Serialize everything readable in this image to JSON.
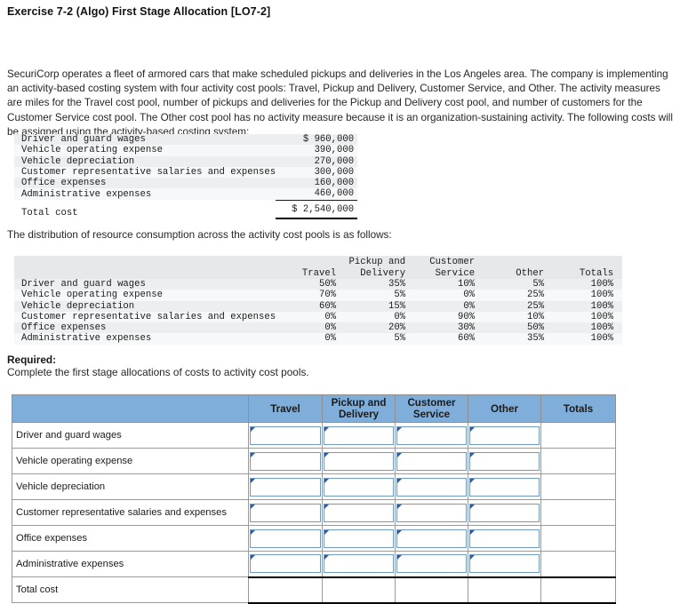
{
  "title": "Exercise 7-2 (Algo) First Stage Allocation [LO7-2]",
  "intro": "SecuriCorp operates a fleet of armored cars that make scheduled pickups and deliveries in the Los Angeles area. The company is implementing an activity-based costing system with four activity cost pools: Travel, Pickup and Delivery, Customer Service, and Other. The activity measures are miles for the Travel cost pool, number of pickups and deliveries for the Pickup and Delivery cost pool, and number of customers for the Customer Service cost pool. The Other cost pool has no activity measure because it is an organization-sustaining activity. The following costs will be assigned using the activity-based costing system:",
  "cost_table": {
    "rows": [
      {
        "label": "Driver and guard wages",
        "value": "$ 960,000"
      },
      {
        "label": "Vehicle operating expense",
        "value": "390,000"
      },
      {
        "label": "Vehicle depreciation",
        "value": "270,000"
      },
      {
        "label": "Customer representative salaries and expenses",
        "value": "300,000"
      },
      {
        "label": "Office expenses",
        "value": "160,000"
      },
      {
        "label": "Administrative expenses",
        "value": "460,000"
      }
    ],
    "total_label": "Total cost",
    "total_value": "$ 2,540,000"
  },
  "midtext": "The distribution of resource consumption across the activity cost pools is as follows:",
  "dist_table": {
    "headers_line1": [
      "",
      "",
      "Pickup and",
      "Customer",
      "",
      ""
    ],
    "headers_line2": [
      "",
      "Travel",
      "Delivery",
      "Service",
      "Other",
      "Totals"
    ],
    "rows": [
      {
        "label": "Driver and guard wages",
        "travel": "50%",
        "pickup": "35%",
        "customer": "10%",
        "other": "5%",
        "totals": "100%"
      },
      {
        "label": "Vehicle operating expense",
        "travel": "70%",
        "pickup": "5%",
        "customer": "0%",
        "other": "25%",
        "totals": "100%"
      },
      {
        "label": "Vehicle depreciation",
        "travel": "60%",
        "pickup": "15%",
        "customer": "0%",
        "other": "25%",
        "totals": "100%"
      },
      {
        "label": "Customer representative salaries and expenses",
        "travel": "0%",
        "pickup": "0%",
        "customer": "90%",
        "other": "10%",
        "totals": "100%"
      },
      {
        "label": "Office expenses",
        "travel": "0%",
        "pickup": "20%",
        "customer": "30%",
        "other": "50%",
        "totals": "100%"
      },
      {
        "label": "Administrative expenses",
        "travel": "0%",
        "pickup": "5%",
        "customer": "60%",
        "other": "35%",
        "totals": "100%"
      }
    ]
  },
  "required": {
    "heading": "Required:",
    "body": "Complete the first stage allocations of costs to activity cost pools."
  },
  "answer_table": {
    "header_corner": "",
    "headers": [
      "Travel",
      "Pickup and\nDelivery",
      "Customer\nService",
      "Other",
      "Totals"
    ],
    "header_travel": "Travel",
    "header_pickup_l1": "Pickup and",
    "header_pickup_l2": "Delivery",
    "header_customer_l1": "Customer",
    "header_customer_l2": "Service",
    "header_other": "Other",
    "header_totals": "Totals",
    "rows": [
      {
        "label": "Driver and guard wages",
        "travel": "",
        "pickup": "",
        "customer": "",
        "other": "",
        "totals": ""
      },
      {
        "label": "Vehicle operating expense",
        "travel": "",
        "pickup": "",
        "customer": "",
        "other": "",
        "totals": ""
      },
      {
        "label": "Vehicle depreciation",
        "travel": "",
        "pickup": "",
        "customer": "",
        "other": "",
        "totals": ""
      },
      {
        "label": "Customer representative salaries and expenses",
        "travel": "",
        "pickup": "",
        "customer": "",
        "other": "",
        "totals": ""
      },
      {
        "label": "Office expenses",
        "travel": "",
        "pickup": "",
        "customer": "",
        "other": "",
        "totals": ""
      },
      {
        "label": "Administrative expenses",
        "travel": "",
        "pickup": "",
        "customer": "",
        "other": "",
        "totals": ""
      }
    ],
    "total_row": {
      "label": "Total cost",
      "travel": "",
      "pickup": "",
      "customer": "",
      "other": "",
      "totals": ""
    }
  },
  "colors": {
    "header_blue": "#7FAEDB",
    "input_border_blue": "#6e9ac4",
    "marker_blue": "#2f5c9e",
    "grid_gray": "#9a9a9a",
    "band_gray": "#eceef0"
  }
}
